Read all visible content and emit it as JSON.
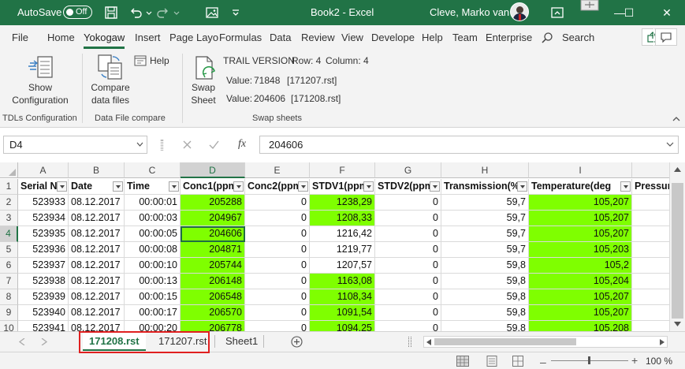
{
  "titlebar": {
    "autosave_label": "AutoSave",
    "autosave_state": "Off",
    "document_title": "Book2 - Excel",
    "user_name": "Cleve, Marko van",
    "accent": "#217346"
  },
  "tabs": [
    "File",
    "Home",
    "Yokogaw",
    "Insert",
    "Page Layo",
    "Formulas",
    "Data",
    "Review",
    "View",
    "Develope",
    "Help",
    "Team",
    "Enterprise"
  ],
  "active_tab": "Yokogaw",
  "search_label": "Search",
  "ribbon": {
    "show_config": [
      "Show",
      "Configuration"
    ],
    "compare": [
      "Compare",
      "data files"
    ],
    "help": "Help",
    "swap": [
      "Swap",
      "Sheet"
    ],
    "trail": "TRAIL VERSION",
    "row_info": "Row: 4",
    "col_info": "Column: 4",
    "value1_label": "Value:",
    "value1": "71848",
    "file1": "[171207.rst]",
    "value2_label": "Value:",
    "value2": "204606",
    "file2": "[171208.rst]",
    "groups": {
      "tdls": "TDLs Configuration",
      "datafile": "Data File compare",
      "swap": "Swap sheets"
    }
  },
  "formula_bar": {
    "name_box": "D4",
    "fx_label": "fx",
    "content": "204606"
  },
  "grid": {
    "columns": [
      "A",
      "B",
      "C",
      "D",
      "E",
      "F",
      "G",
      "H",
      "I",
      ""
    ],
    "selected_column": "D",
    "selected_row": "4",
    "headers": [
      "Serial N",
      "Date",
      "Time",
      "Conc1(ppm",
      "Conc2(ppm",
      "STDV1(ppm",
      "STDV2(ppm",
      "Transmission(%",
      "Temperature(deg",
      "Pressur"
    ],
    "rows": [
      {
        "n": "2",
        "cells": [
          "523933",
          "08.12.2017",
          "00:00:01",
          "205288",
          "0",
          "1238,29",
          "0",
          "59,7",
          "105,207",
          ""
        ]
      },
      {
        "n": "3",
        "cells": [
          "523934",
          "08.12.2017",
          "00:00:03",
          "204967",
          "0",
          "1208,33",
          "0",
          "59,7",
          "105,207",
          ""
        ]
      },
      {
        "n": "4",
        "cells": [
          "523935",
          "08.12.2017",
          "00:00:05",
          "204606",
          "0",
          "1216,42",
          "0",
          "59,7",
          "105,207",
          ""
        ]
      },
      {
        "n": "5",
        "cells": [
          "523936",
          "08.12.2017",
          "00:00:08",
          "204871",
          "0",
          "1219,77",
          "0",
          "59,7",
          "105,203",
          ""
        ]
      },
      {
        "n": "6",
        "cells": [
          "523937",
          "08.12.2017",
          "00:00:10",
          "205744",
          "0",
          "1207,57",
          "0",
          "59,8",
          "105,2",
          ""
        ]
      },
      {
        "n": "7",
        "cells": [
          "523938",
          "08.12.2017",
          "00:00:13",
          "206148",
          "0",
          "1163,08",
          "0",
          "59,8",
          "105,204",
          ""
        ]
      },
      {
        "n": "8",
        "cells": [
          "523939",
          "08.12.2017",
          "00:00:15",
          "206548",
          "0",
          "1108,34",
          "0",
          "59,8",
          "105,207",
          ""
        ]
      },
      {
        "n": "9",
        "cells": [
          "523940",
          "08.12.2017",
          "00:00:17",
          "206570",
          "0",
          "1091,54",
          "0",
          "59,8",
          "105,207",
          ""
        ]
      },
      {
        "n": "10",
        "cells": [
          "523941",
          "08.12.2017",
          "00:00:20",
          "206778",
          "0",
          "1094,25",
          "0",
          "59,8",
          "105,208",
          ""
        ]
      }
    ],
    "green_color": "#7fff00"
  },
  "sheets": {
    "tabs": [
      "171208.rst",
      "171207.rst",
      "Sheet1"
    ],
    "active": "171208.rst"
  },
  "status": {
    "zoom": "100 %"
  }
}
